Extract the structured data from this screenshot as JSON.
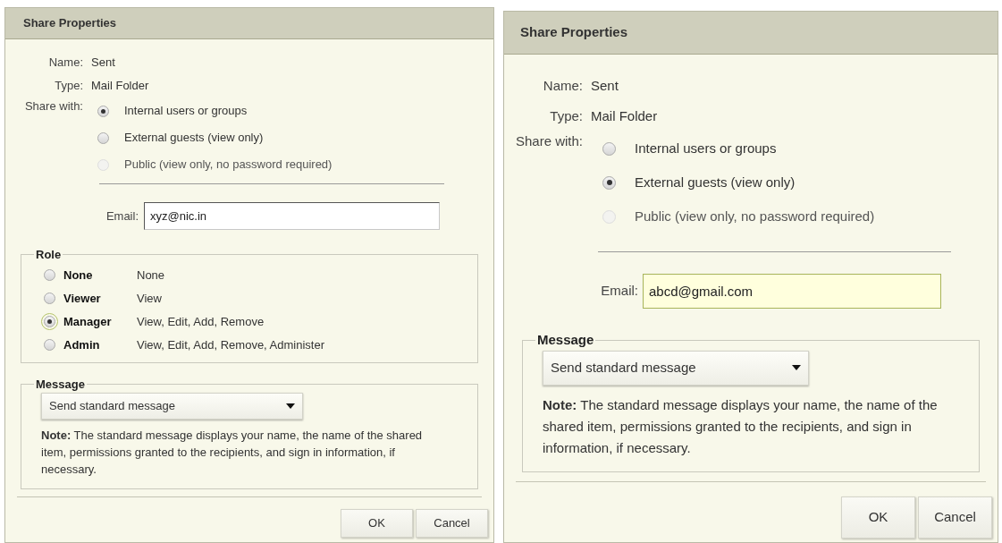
{
  "dialogs": [
    {
      "title": "Share Properties",
      "name_label": "Name:",
      "name": "Sent",
      "type_label": "Type:",
      "type": "Mail Folder",
      "share_label": "Share with:",
      "share_options": [
        {
          "label": "Internal users or groups",
          "selected": true,
          "disabled": false
        },
        {
          "label": "External guests (view only)",
          "selected": false,
          "disabled": false
        },
        {
          "label": "Public (view only, no password required)",
          "selected": false,
          "disabled": true
        }
      ],
      "email_label": "Email:",
      "email": "xyz@nic.in",
      "email_focused": false,
      "role": {
        "legend": "Role",
        "options": [
          {
            "name": "None",
            "description": "None",
            "selected": false,
            "focused": false
          },
          {
            "name": "Viewer",
            "description": "View",
            "selected": false,
            "focused": false
          },
          {
            "name": "Manager",
            "description": "View, Edit, Add, Remove",
            "selected": true,
            "focused": true
          },
          {
            "name": "Admin",
            "description": "View, Edit, Add, Remove, Administer",
            "selected": false,
            "focused": false
          }
        ]
      },
      "message": {
        "legend": "Message",
        "select": "Send standard message",
        "note": "**Note:** The standard message displays your name, the name of the shared item, permissions granted to the recipients, and sign in information, if necessary."
      },
      "buttons": [
        "OK",
        "Cancel"
      ]
    },
    {
      "title": "Share Properties",
      "name_label": "Name:",
      "name": "Sent",
      "type_label": "Type:",
      "type": "Mail Folder",
      "share_label": "Share with:",
      "share_options": [
        {
          "label": "Internal users or groups",
          "selected": false,
          "disabled": false
        },
        {
          "label": "External guests (view only)",
          "selected": true,
          "disabled": false
        },
        {
          "label": "Public (view only, no password required)",
          "selected": false,
          "disabled": true
        }
      ],
      "email_label": "Email:",
      "email": "abcd@gmail.com",
      "email_focused": true,
      "message": {
        "legend": "Message",
        "select": "Send standard message",
        "note": "**Note:** The standard message displays your name, the name of the shared item, permissions granted to the recipients, and sign in information, if necessary."
      },
      "buttons": [
        "OK",
        "Cancel"
      ]
    }
  ]
}
